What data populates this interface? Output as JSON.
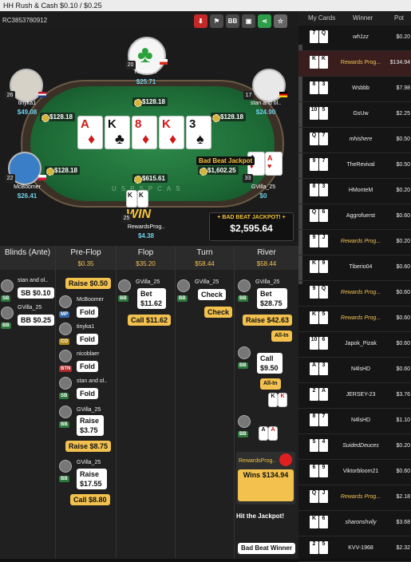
{
  "titlebar": {
    "title": "HH  Rush & Cash $0.10 / $0.25"
  },
  "header": {
    "hand_id": "RC3853780912",
    "bb_label": "BB"
  },
  "colors": {
    "accent_yellow": "#f2c14e",
    "stack_cyan": "#6fd0e8",
    "felt_green": "#1d6a36",
    "jackpot_gold": "#f3c23c"
  },
  "players": {
    "nicoblaer": {
      "name": "nicoblaer",
      "stack": "$25.71",
      "level": "20",
      "bet": "$128.18"
    },
    "tinyka1": {
      "name": "tinyka1",
      "stack": "$49.08",
      "level": "26",
      "bet": "$128.18"
    },
    "stan": {
      "name": "stan and ol..",
      "stack": "$24.90",
      "level": "17",
      "bet": "$128.18"
    },
    "mcboomer": {
      "name": "McBoomer",
      "stack": "$26.41",
      "level": "22",
      "bet": "$128.18"
    },
    "gvilla": {
      "name": "GVilla_25",
      "stack": "$0",
      "level": "33",
      "bet": "$1,602.25"
    },
    "rewards": {
      "name": "RewardsProg..",
      "stack": "$4.38",
      "level": "25"
    }
  },
  "pot": {
    "amount": "$615.61"
  },
  "board": [
    {
      "r": "A",
      "s": "♦",
      "red": true
    },
    {
      "r": "K",
      "s": "♣",
      "red": false
    },
    {
      "r": "8",
      "s": "♦",
      "red": true
    },
    {
      "r": "K",
      "s": "♦",
      "red": true
    },
    {
      "r": "3",
      "s": "♠",
      "red": false
    }
  ],
  "table": {
    "logo": "USPSPCAS",
    "bad_beat_label": "Bad Beat Jackpot",
    "win_label": "WIN"
  },
  "bad_beat": {
    "title": "+ BAD BEAT JACKPOT! +",
    "amount": "$2,595.64"
  },
  "streets": {
    "blinds": {
      "name": "Blinds (Ante)",
      "items": [
        {
          "player": "stan and ol..",
          "pos": "SB",
          "action": "SB $0.10"
        },
        {
          "player": "GVilla_25",
          "pos": "BB",
          "action": "BB $0.25"
        }
      ]
    },
    "preflop": {
      "name": "Pre-Flop",
      "pot": "$0.35",
      "items": [
        {
          "player": "",
          "pos": "",
          "action": "Raise $0.50"
        },
        {
          "player": "McBoomer",
          "pos": "MP",
          "action": "Fold"
        },
        {
          "player": "tinyka1",
          "pos": "CO",
          "action": "Fold"
        },
        {
          "player": "nicoblaer",
          "pos": "BTN",
          "action": "Fold"
        },
        {
          "player": "stan and ol..",
          "pos": "SB",
          "action": "Fold"
        },
        {
          "player": "GVilla_25",
          "pos": "BB",
          "action": "Raise $3.75"
        },
        {
          "player": "",
          "pos": "",
          "action": "Raise $8.75"
        },
        {
          "player": "GVilla_25",
          "pos": "BB",
          "action": "Raise $17.55"
        },
        {
          "player": "",
          "pos": "",
          "action": "Call $8.80"
        }
      ]
    },
    "flop": {
      "name": "Flop",
      "pot": "$35.20",
      "items": [
        {
          "player": "GVilla_25",
          "pos": "BB",
          "action": "Bet $11.62"
        },
        {
          "player": "",
          "pos": "",
          "action": "Call $11.62"
        }
      ]
    },
    "turn": {
      "name": "Turn",
      "pot": "$58.44",
      "items": [
        {
          "player": "GVilla_25",
          "pos": "BB",
          "action": "Check"
        },
        {
          "player": "",
          "pos": "",
          "action": "Check"
        }
      ]
    },
    "river": {
      "name": "River",
      "pot": "$58.44",
      "items": [
        {
          "player": "GVilla_25",
          "pos": "BB",
          "action": "Bet $28.75"
        },
        {
          "player": "",
          "pos": "",
          "action": "Raise $42.63"
        },
        {
          "player": "",
          "pos": "",
          "action": "All-In"
        },
        {
          "player": "",
          "pos": "BB",
          "action": "Call $9.50"
        },
        {
          "player": "",
          "pos": "",
          "action": "All-In"
        },
        {
          "player": "RewardsProg..",
          "pos": "",
          "action": "Wins $134.94"
        },
        {
          "player": "",
          "pos": "",
          "action": "Hit the Jackpot!"
        },
        {
          "player": "",
          "pos": "",
          "action": "Bad Beat Winner"
        }
      ]
    }
  },
  "hand_list": {
    "headers": [
      "My Cards",
      "Winner",
      "Pot"
    ],
    "rows": [
      {
        "cards": [
          "7",
          "Q"
        ],
        "winner": "wh1zz",
        "pot": "$0.20",
        "italic": true
      },
      {
        "cards": [
          "K",
          "K"
        ],
        "winner": "Rewards Prog...",
        "pot": "$134.94",
        "highlight": true
      },
      {
        "cards": [
          "8",
          "3"
        ],
        "winner": "Wsbbb",
        "pot": "$7.98"
      },
      {
        "cards": [
          "10",
          "5"
        ],
        "winner": "GsUw",
        "pot": "$2.25"
      },
      {
        "cards": [
          "Q",
          "7"
        ],
        "winner": "mhishere",
        "pot": "$0.50",
        "italic": true
      },
      {
        "cards": [
          "9",
          "7"
        ],
        "winner": "TheRevival",
        "pot": "$0.50"
      },
      {
        "cards": [
          "8",
          "3"
        ],
        "winner": "HMonteM",
        "pot": "$0.20"
      },
      {
        "cards": [
          "Q",
          "6"
        ],
        "winner": "Aggrofuerst",
        "pot": "$0.60"
      },
      {
        "cards": [
          "9",
          "J"
        ],
        "winner": "Rewards Prog...",
        "pot": "$0.20",
        "italic": true
      },
      {
        "cards": [
          "K",
          "9"
        ],
        "winner": "Tiberio04",
        "pot": "$0.60"
      },
      {
        "cards": [
          "9",
          "Q"
        ],
        "winner": "Rewards Prog...",
        "pot": "$0.60",
        "italic": true
      },
      {
        "cards": [
          "K",
          "5"
        ],
        "winner": "Rewards Prog...",
        "pot": "$0.60",
        "italic": true
      },
      {
        "cards": [
          "10",
          "6"
        ],
        "winner": "Japok_Pizak",
        "pot": "$0.60"
      },
      {
        "cards": [
          "A",
          "3"
        ],
        "winner": "N4lsHD",
        "pot": "$0.60"
      },
      {
        "cards": [
          "2",
          "A"
        ],
        "winner": "JERSEY-23",
        "pot": "$3.76"
      },
      {
        "cards": [
          "8",
          "7"
        ],
        "winner": "N4lsHD",
        "pot": "$1.10"
      },
      {
        "cards": [
          "5",
          "4"
        ],
        "winner": "SuidedDeuces",
        "pot": "$0.20",
        "italic": true
      },
      {
        "cards": [
          "6",
          "9"
        ],
        "winner": "Viktorbloom21",
        "pot": "$0.60"
      },
      {
        "cards": [
          "Q",
          "J"
        ],
        "winner": "Rewards Prog...",
        "pot": "$2.18",
        "italic": true
      },
      {
        "cards": [
          "K",
          "6"
        ],
        "winner": "sharonshvily",
        "pot": "$3.68",
        "italic": true
      },
      {
        "cards": [
          "2",
          "5"
        ],
        "winner": "KVV-1968",
        "pot": "$2.32"
      }
    ]
  }
}
